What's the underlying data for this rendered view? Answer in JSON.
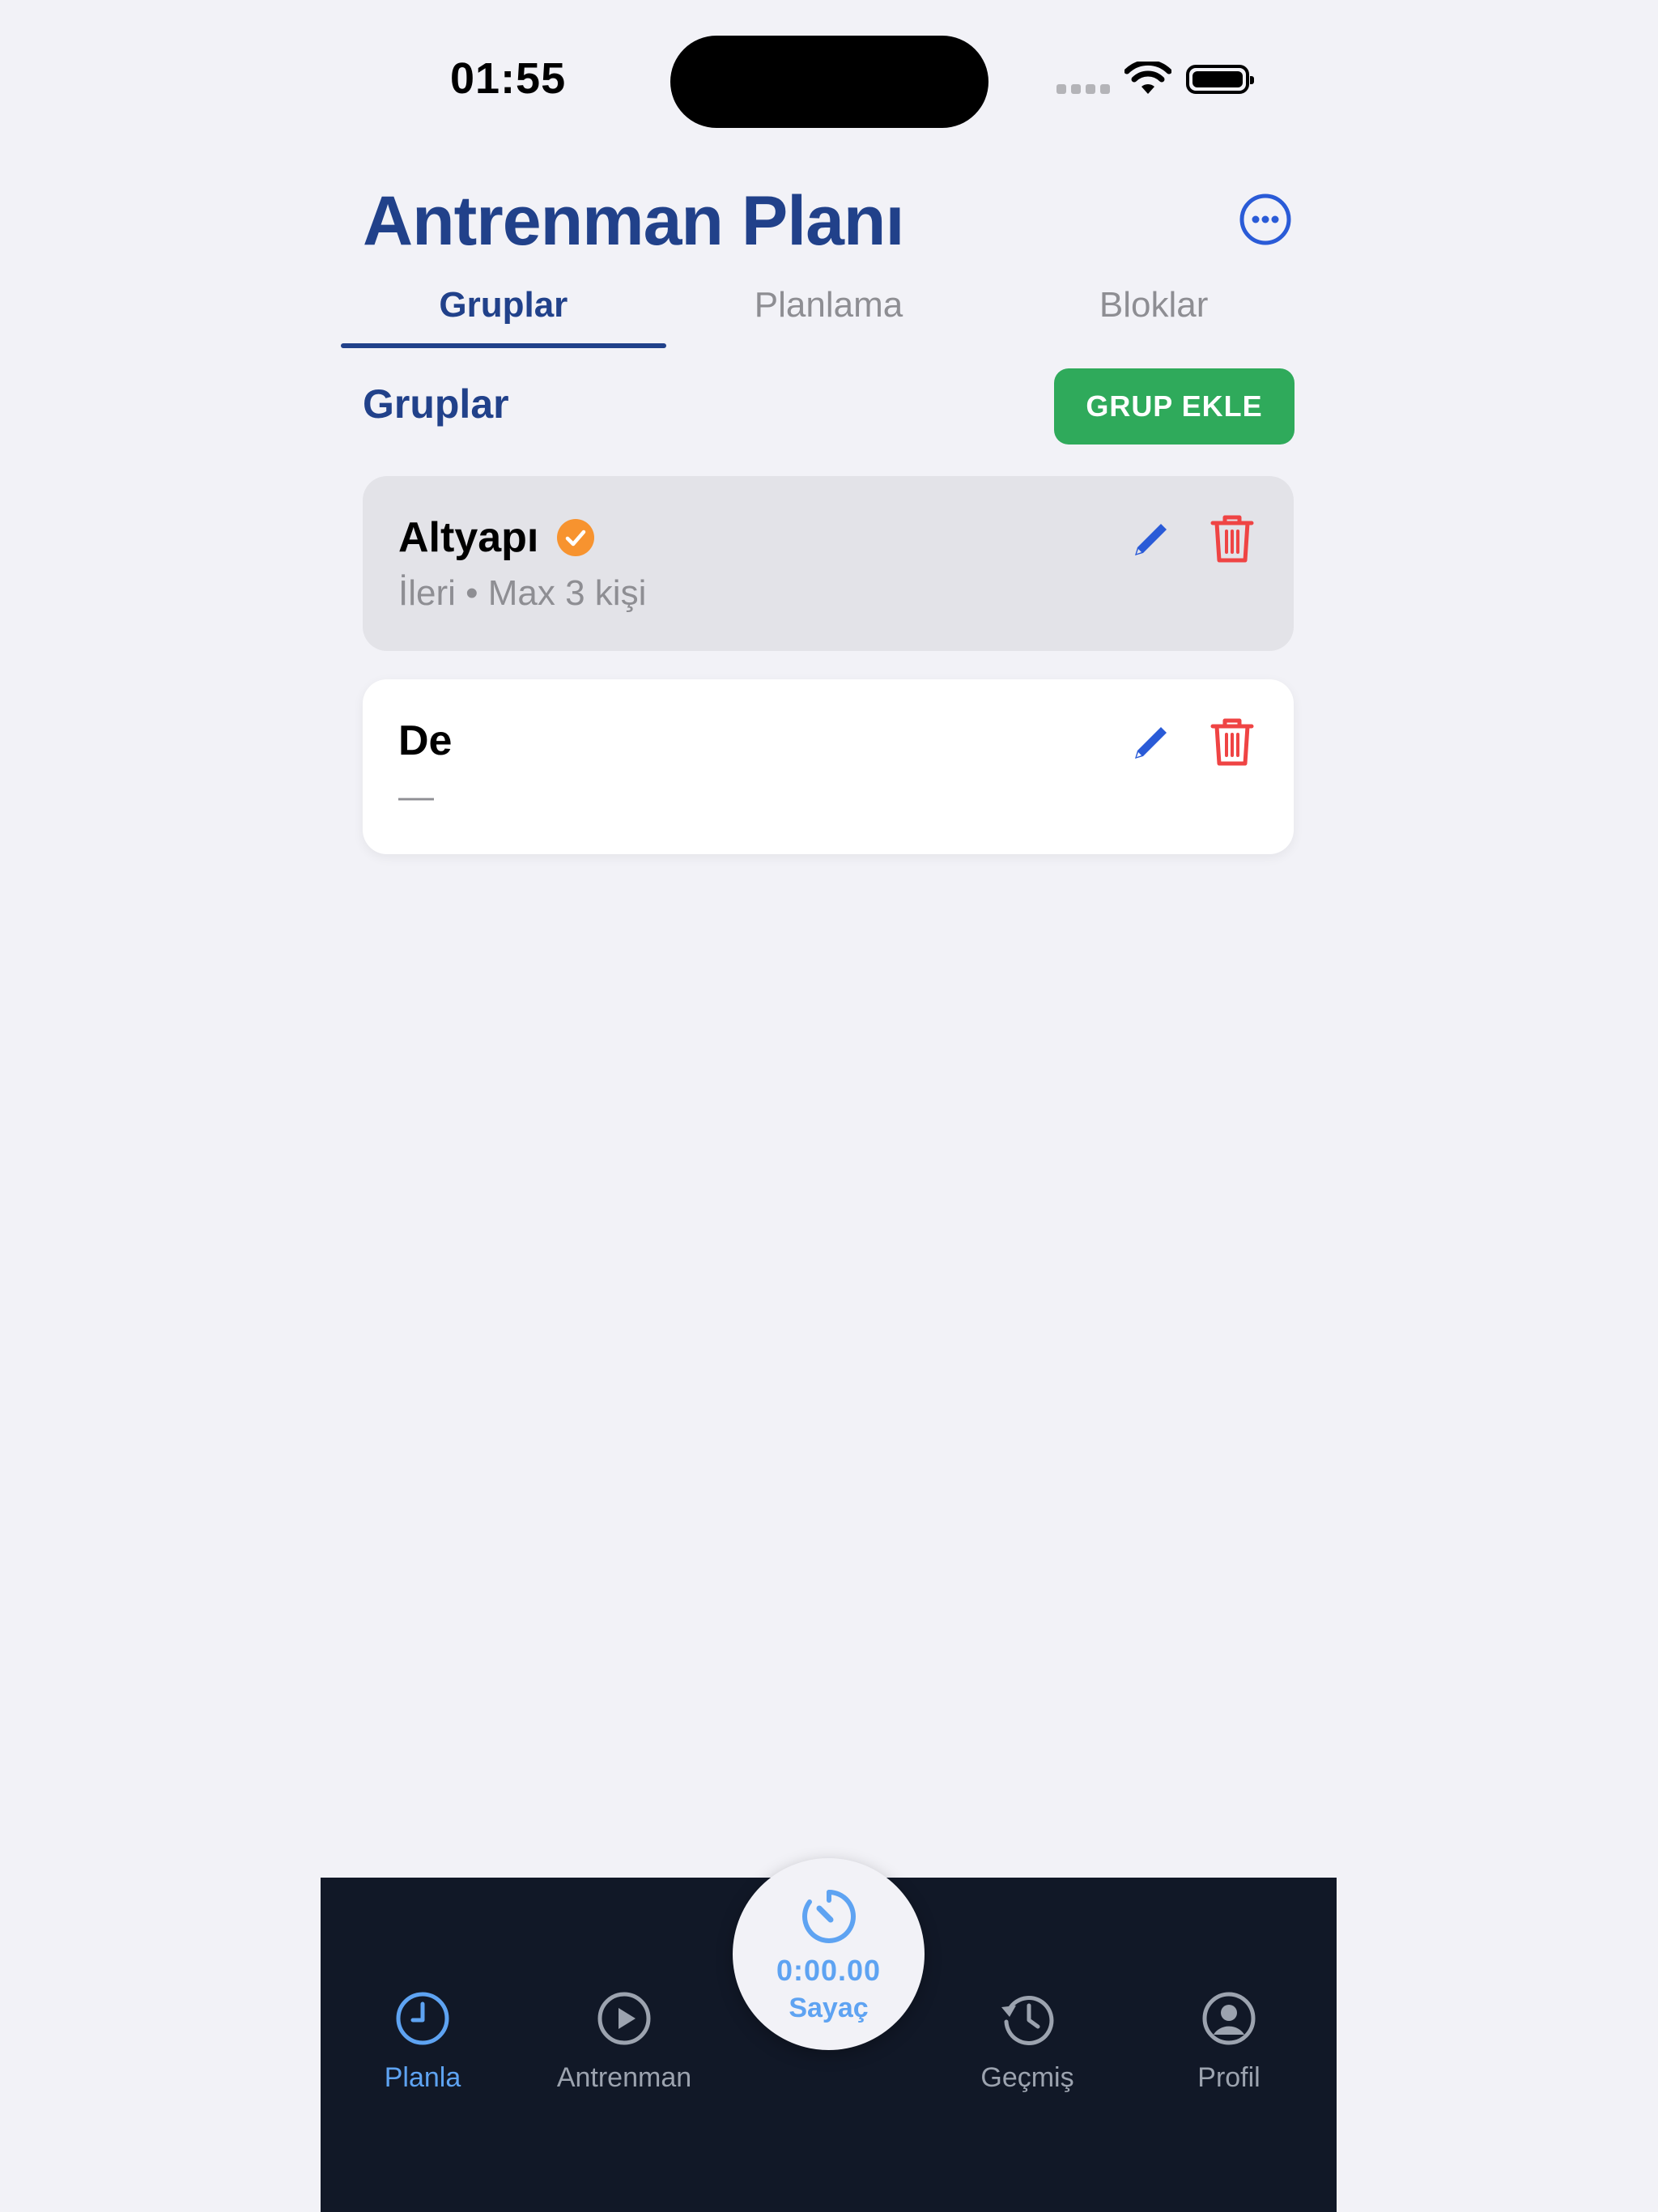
{
  "status_bar": {
    "time": "01:55"
  },
  "header": {
    "title": "Antrenman Planı",
    "more_icon": "ellipsis-circle-icon"
  },
  "tabs": [
    {
      "label": "Gruplar",
      "active": true
    },
    {
      "label": "Planlama",
      "active": false
    },
    {
      "label": "Bloklar",
      "active": false
    }
  ],
  "section": {
    "title": "Gruplar",
    "add_button_label": "GRUP EKLE"
  },
  "groups": [
    {
      "name": "Altyapı",
      "meta": "İleri • Max 3 kişi",
      "selected": true,
      "badge_icon": "check-circle-icon"
    },
    {
      "name": "De",
      "meta": "—",
      "selected": false
    }
  ],
  "bottom_nav": {
    "items": [
      {
        "label": "Planla",
        "icon": "clock-icon",
        "active": true
      },
      {
        "label": "Antrenman",
        "icon": "play-circle-icon",
        "active": false
      },
      {
        "label": "Geçmiş",
        "icon": "history-icon",
        "active": false
      },
      {
        "label": "Profil",
        "icon": "person-circle-icon",
        "active": false
      }
    ],
    "timer": {
      "value": "0:00.00",
      "label": "Sayaç",
      "icon": "stopwatch-icon"
    }
  },
  "colors": {
    "primary": "#21418a",
    "accent_green": "#2faa5b",
    "badge_orange": "#f7932f",
    "edit_blue": "#2a5bd7",
    "delete_red": "#ef4444",
    "nav_background": "#111827",
    "nav_active": "#5ea3f2"
  }
}
